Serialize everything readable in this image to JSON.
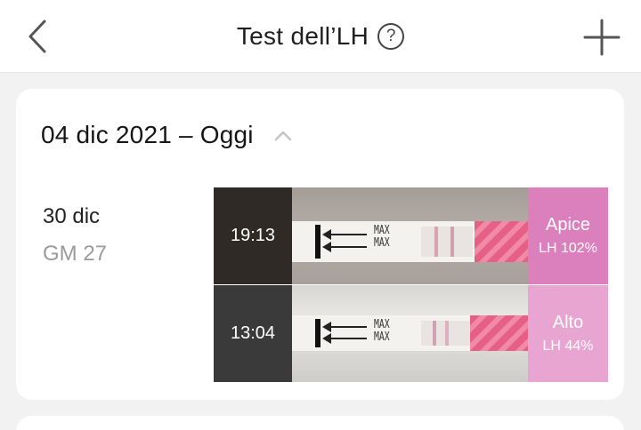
{
  "header": {
    "title": "Test dell’LH",
    "help_glyph": "?",
    "back_icon": "chevron-left-icon",
    "add_icon": "plus-icon"
  },
  "section": {
    "range_label": "04 dic 2021 – Oggi",
    "collapse_icon": "chevron-up-icon"
  },
  "day": {
    "date": "30 dic",
    "cycle_day": "GM 27"
  },
  "tests": [
    {
      "time": "19:13",
      "level": "Apice",
      "value": "LH 102%",
      "color": "#dc7fbd"
    },
    {
      "time": "13:04",
      "level": "Alto",
      "value": "LH 44%",
      "color": "#e9a5d2"
    }
  ],
  "strip_marking": "MAX\nMAX"
}
